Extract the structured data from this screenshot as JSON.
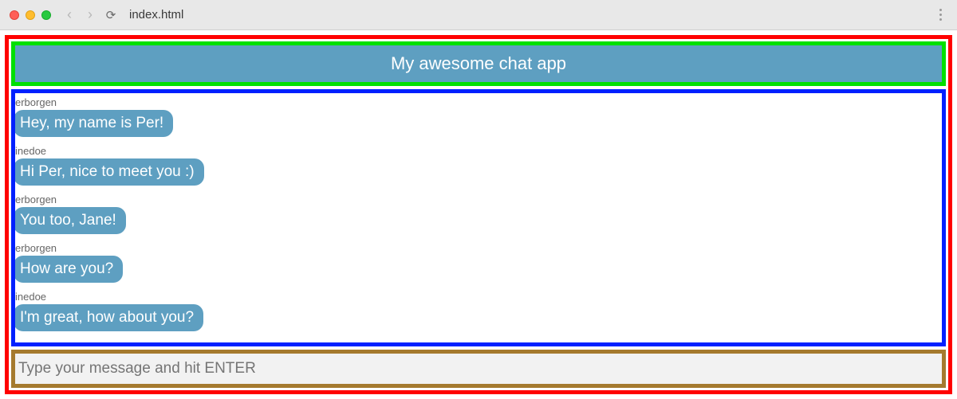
{
  "browser": {
    "url": "index.html"
  },
  "header": {
    "title": "My awesome chat app"
  },
  "messages": [
    {
      "user": "erborgen",
      "text": "Hey, my name is Per!"
    },
    {
      "user": "inedoe",
      "text": "Hi Per, nice to meet you :)"
    },
    {
      "user": "erborgen",
      "text": "You too, Jane!"
    },
    {
      "user": "erborgen",
      "text": "How are you?"
    },
    {
      "user": "inedoe",
      "text": "I'm great, how about you?"
    }
  ],
  "input": {
    "placeholder": "Type your message and hit ENTER"
  }
}
